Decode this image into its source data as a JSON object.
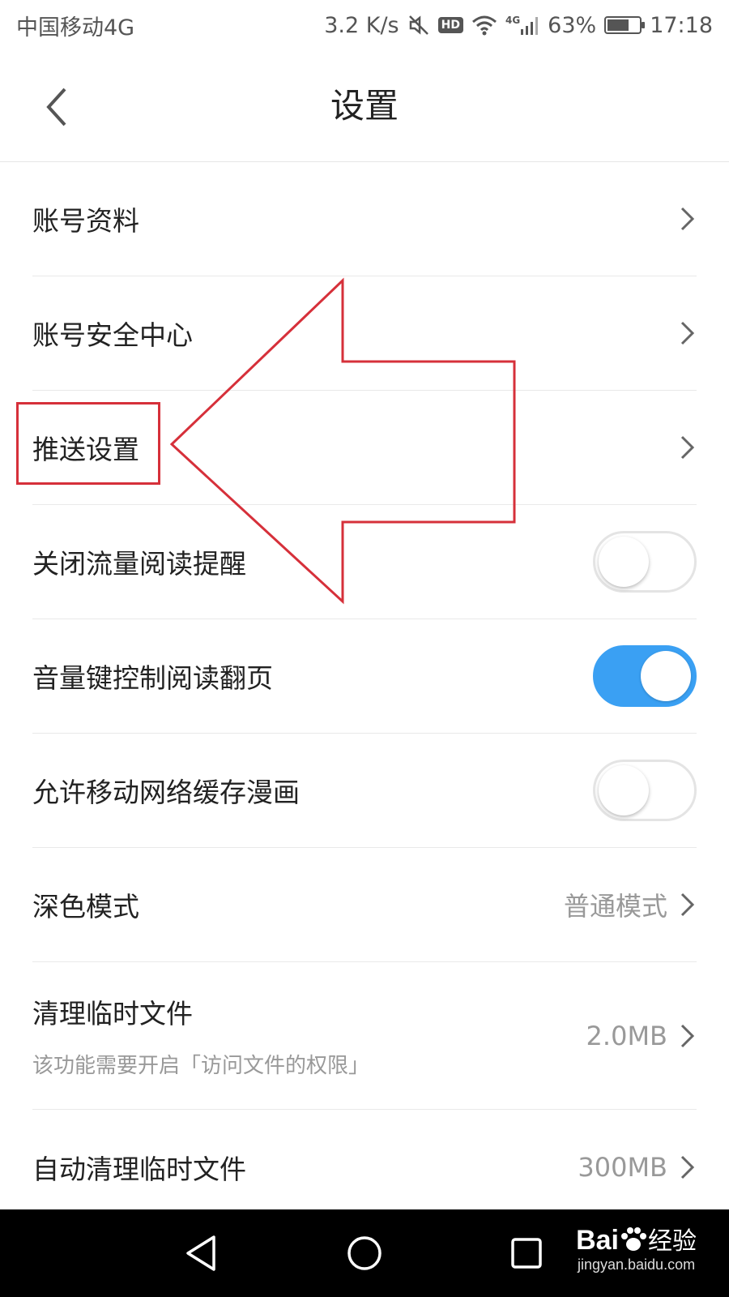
{
  "status_bar": {
    "carrier": "中国移动4G",
    "speed": "3.2 K/s",
    "hd": "HD",
    "network": "4G",
    "battery": "63%",
    "time": "17:18"
  },
  "header": {
    "title": "设置"
  },
  "settings": {
    "account_info": "账号资料",
    "account_security": "账号安全中心",
    "push_settings": "推送设置",
    "close_traffic_reminder": {
      "label": "关闭流量阅读提醒",
      "enabled": false
    },
    "volume_key_page": {
      "label": "音量键控制阅读翻页",
      "enabled": true
    },
    "mobile_cache_comics": {
      "label": "允许移动网络缓存漫画",
      "enabled": false
    },
    "dark_mode": {
      "label": "深色模式",
      "value": "普通模式"
    },
    "clear_temp": {
      "label": "清理临时文件",
      "sub": "该功能需要开启「访问文件的权限」",
      "value": "2.0MB"
    },
    "auto_clear_temp": {
      "label": "自动清理临时文件",
      "value": "300MB"
    }
  },
  "watermark": {
    "brand": "Bai",
    "brand_cn": "经验",
    "url": "jingyan.baidu.com"
  },
  "colors": {
    "accent": "#3aa0f3",
    "annotation": "#d6303a"
  }
}
